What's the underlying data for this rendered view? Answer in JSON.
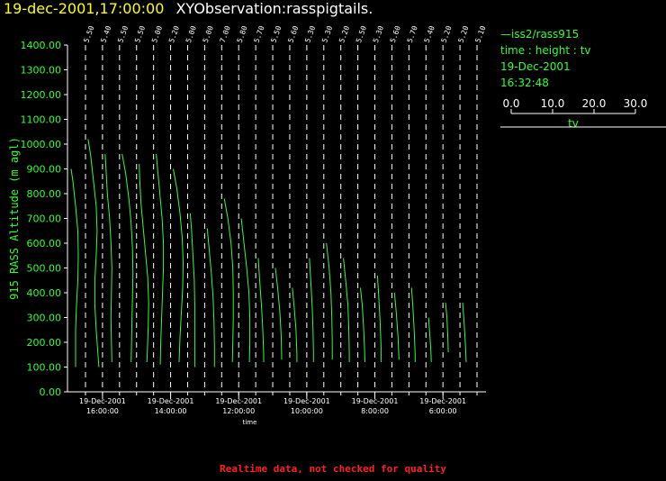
{
  "header": {
    "timestamp": "19-dec-2001,17:00:00",
    "name": "XYObservation:rasspigtails."
  },
  "legend": {
    "station": "iss2/rass915",
    "axes_desc": "time : height : tv",
    "date": "19-Dec-2001",
    "time": "16:32:48",
    "scale_ticks": [
      "0.0",
      "10.0",
      "20.0",
      "30.0"
    ],
    "scale_label": "tv"
  },
  "footer": "Realtime data, not checked for quality",
  "colors": {
    "data": "#33ff33",
    "axis": "#ffffff",
    "title_time": "#ffff00",
    "footer": "#ff2020",
    "ylabel": "#33ff33"
  },
  "chart_data": {
    "type": "line",
    "ylabel": "915 RASS Altitude (m agl)",
    "xlabel": "time",
    "ylim": [
      0,
      1400
    ],
    "yticks": [
      "0.00",
      "100.00",
      "200.00",
      "300.00",
      "400.00",
      "500.00",
      "600.00",
      "700.00",
      "800.00",
      "900.00",
      "1000.00",
      "1100.00",
      "1200.00",
      "1300.00",
      "1400.00"
    ],
    "x_direction": "decreasing time left to right",
    "xticks": [
      {
        "date": "19-Dec-2001",
        "time": "16:00:00"
      },
      {
        "date": "19-Dec-2001",
        "time": "14:00:00"
      },
      {
        "date": "19-Dec-2001",
        "time": "12:00:00"
      },
      {
        "date": "19-Dec-2001",
        "time": "10:00:00"
      },
      {
        "date": "19-Dec-2001",
        "time": "8:00:00"
      },
      {
        "date": "19-Dec-2001",
        "time": "6:00:00"
      }
    ],
    "top_labels": [
      "5.50",
      "5.40",
      "5.50",
      "5.50",
      "5.00",
      "5.20",
      "5.00",
      "5.00",
      "7.00",
      "5.80",
      "5.70",
      "5.50",
      "5.60",
      "5.30",
      "5.30",
      "5.20",
      "5.50",
      "5.30",
      "5.60",
      "5.70",
      "5.40",
      "5.20",
      "5.20",
      "5.10"
    ],
    "series": [
      {
        "xpos": 0,
        "points": [
          [
            900,
            0.0
          ],
          [
            850,
            0.4
          ],
          [
            750,
            1.0
          ],
          [
            650,
            1.5
          ],
          [
            550,
            1.6
          ],
          [
            450,
            1.5
          ],
          [
            350,
            1.2
          ],
          [
            250,
            1.0
          ],
          [
            150,
            1.0
          ],
          [
            100,
            1.0
          ]
        ]
      },
      {
        "xpos": 1,
        "points": [
          [
            1020,
            0.0
          ],
          [
            950,
            0.6
          ],
          [
            850,
            1.2
          ],
          [
            750,
            1.8
          ],
          [
            650,
            2.0
          ],
          [
            550,
            1.8
          ],
          [
            450,
            1.5
          ],
          [
            350,
            1.5
          ],
          [
            250,
            1.8
          ],
          [
            150,
            2.2
          ],
          [
            100,
            2.4
          ]
        ]
      },
      {
        "xpos": 2,
        "points": [
          [
            960,
            0.0
          ],
          [
            900,
            0.2
          ],
          [
            800,
            0.5
          ],
          [
            700,
            1.0
          ],
          [
            600,
            1.3
          ],
          [
            500,
            1.5
          ],
          [
            400,
            1.4
          ],
          [
            300,
            1.3
          ],
          [
            200,
            1.4
          ],
          [
            120,
            1.5
          ]
        ]
      },
      {
        "xpos": 3,
        "points": [
          [
            960,
            0.0
          ],
          [
            880,
            0.8
          ],
          [
            780,
            1.5
          ],
          [
            680,
            2.0
          ],
          [
            580,
            2.3
          ],
          [
            480,
            2.4
          ],
          [
            380,
            2.3
          ],
          [
            300,
            2.2
          ],
          [
            200,
            2.1
          ],
          [
            120,
            2.0
          ]
        ]
      },
      {
        "xpos": 4,
        "points": [
          [
            920,
            0.0
          ],
          [
            860,
            0.1
          ],
          [
            760,
            0.4
          ],
          [
            660,
            0.9
          ],
          [
            560,
            1.4
          ],
          [
            460,
            1.9
          ],
          [
            360,
            2.1
          ],
          [
            260,
            2.0
          ],
          [
            160,
            1.8
          ],
          [
            120,
            1.7
          ]
        ]
      },
      {
        "xpos": 5,
        "points": [
          [
            960,
            0.0
          ],
          [
            900,
            0.3
          ],
          [
            800,
            0.8
          ],
          [
            700,
            1.3
          ],
          [
            600,
            1.6
          ],
          [
            500,
            1.6
          ],
          [
            400,
            1.4
          ],
          [
            300,
            1.2
          ],
          [
            200,
            1.0
          ],
          [
            110,
            0.9
          ]
        ]
      },
      {
        "xpos": 6,
        "points": [
          [
            900,
            0.0
          ],
          [
            820,
            0.8
          ],
          [
            720,
            1.5
          ],
          [
            620,
            2.0
          ],
          [
            520,
            2.2
          ],
          [
            420,
            2.1
          ],
          [
            320,
            1.8
          ],
          [
            220,
            1.5
          ],
          [
            120,
            1.3
          ]
        ]
      },
      {
        "xpos": 7,
        "points": [
          [
            720,
            0.0
          ],
          [
            650,
            0.3
          ],
          [
            550,
            0.6
          ],
          [
            450,
            0.9
          ],
          [
            350,
            1.0
          ],
          [
            250,
            1.0
          ],
          [
            150,
            1.0
          ],
          [
            100,
            1.0
          ]
        ]
      },
      {
        "xpos": 8,
        "points": [
          [
            660,
            0.0
          ],
          [
            580,
            0.4
          ],
          [
            480,
            0.9
          ],
          [
            380,
            1.3
          ],
          [
            280,
            1.5
          ],
          [
            180,
            1.6
          ],
          [
            100,
            1.6
          ]
        ]
      },
      {
        "xpos": 9,
        "points": [
          [
            780,
            0.0
          ],
          [
            700,
            0.8
          ],
          [
            600,
            1.5
          ],
          [
            500,
            1.9
          ],
          [
            400,
            2.0
          ],
          [
            300,
            2.0
          ],
          [
            200,
            1.9
          ],
          [
            120,
            1.8
          ]
        ]
      },
      {
        "xpos": 10,
        "points": [
          [
            700,
            0.0
          ],
          [
            600,
            0.6
          ],
          [
            500,
            1.2
          ],
          [
            400,
            1.7
          ],
          [
            300,
            1.9
          ],
          [
            200,
            1.9
          ],
          [
            120,
            1.8
          ]
        ]
      },
      {
        "xpos": 11,
        "points": [
          [
            540,
            0.0
          ],
          [
            450,
            0.3
          ],
          [
            350,
            0.7
          ],
          [
            250,
            1.0
          ],
          [
            150,
            1.2
          ],
          [
            120,
            1.2
          ]
        ]
      },
      {
        "xpos": 12,
        "points": [
          [
            500,
            0.0
          ],
          [
            420,
            0.5
          ],
          [
            320,
            1.0
          ],
          [
            220,
            1.3
          ],
          [
            130,
            1.4
          ]
        ]
      },
      {
        "xpos": 13,
        "points": [
          [
            420,
            0.0
          ],
          [
            340,
            0.4
          ],
          [
            250,
            0.8
          ],
          [
            150,
            1.0
          ],
          [
            120,
            1.0
          ]
        ]
      },
      {
        "xpos": 14,
        "points": [
          [
            540,
            0.0
          ],
          [
            450,
            0.3
          ],
          [
            350,
            0.6
          ],
          [
            250,
            0.8
          ],
          [
            160,
            0.9
          ],
          [
            120,
            0.9
          ]
        ]
      },
      {
        "xpos": 15,
        "points": [
          [
            600,
            0.0
          ],
          [
            500,
            0.6
          ],
          [
            400,
            1.0
          ],
          [
            300,
            1.2
          ],
          [
            200,
            1.3
          ],
          [
            130,
            1.3
          ]
        ]
      },
      {
        "xpos": 16,
        "points": [
          [
            540,
            0.0
          ],
          [
            450,
            0.5
          ],
          [
            350,
            1.0
          ],
          [
            250,
            1.2
          ],
          [
            150,
            1.3
          ],
          [
            120,
            1.3
          ]
        ]
      },
      {
        "xpos": 17,
        "points": [
          [
            420,
            0.0
          ],
          [
            350,
            0.4
          ],
          [
            260,
            0.7
          ],
          [
            180,
            0.9
          ],
          [
            120,
            1.0
          ]
        ]
      },
      {
        "xpos": 18,
        "points": [
          [
            470,
            0.0
          ],
          [
            380,
            0.3
          ],
          [
            280,
            0.6
          ],
          [
            180,
            0.8
          ],
          [
            120,
            0.8
          ]
        ]
      },
      {
        "xpos": 19,
        "points": [
          [
            400,
            0.0
          ],
          [
            320,
            0.4
          ],
          [
            220,
            0.8
          ],
          [
            130,
            1.0
          ]
        ]
      },
      {
        "xpos": 20,
        "points": [
          [
            420,
            0.0
          ],
          [
            340,
            0.3
          ],
          [
            240,
            0.6
          ],
          [
            150,
            0.8
          ],
          [
            120,
            0.8
          ]
        ]
      },
      {
        "xpos": 21,
        "points": [
          [
            300,
            0.0
          ],
          [
            250,
            0.2
          ],
          [
            170,
            0.5
          ],
          [
            120,
            0.6
          ]
        ]
      },
      {
        "xpos": 22,
        "points": [
          [
            360,
            0.0
          ],
          [
            300,
            0.3
          ],
          [
            220,
            0.5
          ],
          [
            160,
            0.6
          ]
        ]
      },
      {
        "xpos": 23,
        "points": [
          [
            360,
            0.0
          ],
          [
            290,
            0.3
          ],
          [
            200,
            0.6
          ],
          [
            120,
            0.8
          ]
        ]
      }
    ]
  }
}
